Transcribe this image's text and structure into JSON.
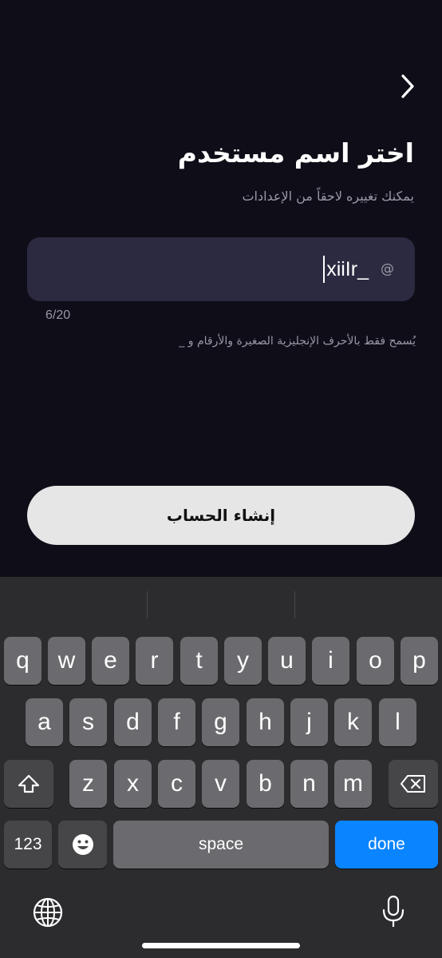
{
  "header": {
    "title": "اختر اسم مستخدم",
    "subtitle": "يمكنك تغييره لاحقاً من الإعدادات"
  },
  "username": {
    "prefix": "@",
    "value": "xiiIr_",
    "counter": "6/20",
    "hint": "يُسمح فقط بالأحرف الإنجليزية الصغيرة والأرقام و _"
  },
  "actions": {
    "create_account": "إنشاء الحساب"
  },
  "keyboard": {
    "row1": [
      "q",
      "w",
      "e",
      "r",
      "t",
      "y",
      "u",
      "i",
      "o",
      "p"
    ],
    "row2": [
      "a",
      "s",
      "d",
      "f",
      "g",
      "h",
      "j",
      "k",
      "l"
    ],
    "row3": [
      "z",
      "x",
      "c",
      "v",
      "b",
      "n",
      "m"
    ],
    "numbers_label": "123",
    "space_label": "space",
    "done_label": "done",
    "done_color": "#0a84ff",
    "icons": [
      "shift-icon",
      "delete-icon",
      "emoji-icon",
      "globe-icon",
      "microphone-icon"
    ]
  }
}
